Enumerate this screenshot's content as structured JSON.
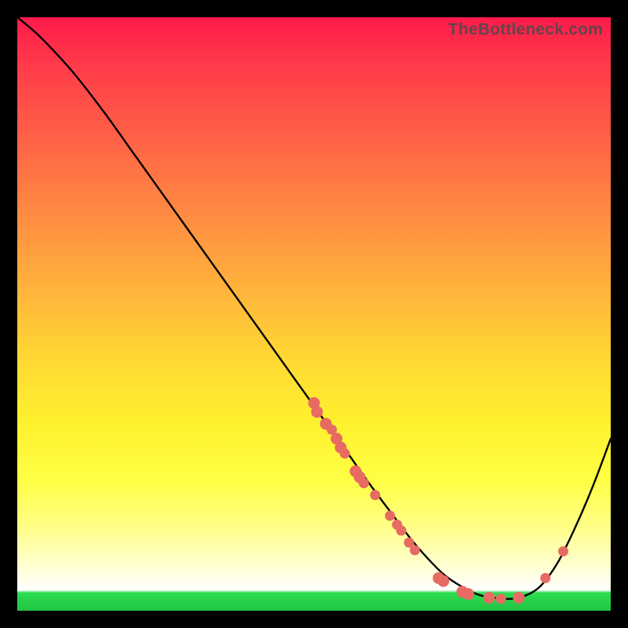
{
  "watermark": "TheBottleneck.com",
  "colors": {
    "dot": "#e86b63",
    "curve": "#000000",
    "frame_bg_top": "#ff1a4a",
    "frame_bg_bottom": "#22c545",
    "page_bg": "#000000"
  },
  "chart_data": {
    "type": "line",
    "title": "",
    "xlabel": "",
    "ylabel": "",
    "xlim": [
      0,
      100
    ],
    "ylim": [
      0,
      100
    ],
    "grid": false,
    "legend": false,
    "series": [
      {
        "name": "bottleneck-curve",
        "x": [
          0,
          3,
          6,
          10,
          15,
          20,
          25,
          30,
          35,
          40,
          45,
          50,
          55,
          60,
          63,
          66,
          69,
          72,
          75,
          78,
          81,
          83,
          85,
          88,
          91,
          94,
          97,
          100
        ],
        "y": [
          100,
          97.5,
          94.5,
          90,
          83.5,
          76.5,
          69.5,
          62.5,
          55.5,
          48.5,
          41.5,
          34.5,
          27.5,
          20.5,
          16.5,
          12.5,
          9,
          6,
          4,
          2.6,
          2.1,
          2.0,
          2.3,
          4,
          8,
          14,
          21,
          29
        ]
      }
    ],
    "points": [
      {
        "x": 50.0,
        "y": 35.0,
        "r": 7
      },
      {
        "x": 50.5,
        "y": 33.5,
        "r": 7
      },
      {
        "x": 52.0,
        "y": 31.5,
        "r": 7
      },
      {
        "x": 53.0,
        "y": 30.5,
        "r": 6
      },
      {
        "x": 53.8,
        "y": 29.0,
        "r": 7
      },
      {
        "x": 54.5,
        "y": 27.5,
        "r": 7
      },
      {
        "x": 55.2,
        "y": 26.5,
        "r": 6
      },
      {
        "x": 57.0,
        "y": 23.5,
        "r": 7
      },
      {
        "x": 57.7,
        "y": 22.5,
        "r": 7
      },
      {
        "x": 58.4,
        "y": 21.5,
        "r": 6
      },
      {
        "x": 60.3,
        "y": 19.5,
        "r": 6
      },
      {
        "x": 62.8,
        "y": 16.0,
        "r": 6
      },
      {
        "x": 64.0,
        "y": 14.5,
        "r": 6
      },
      {
        "x": 64.7,
        "y": 13.5,
        "r": 6
      },
      {
        "x": 66.0,
        "y": 11.5,
        "r": 6
      },
      {
        "x": 67.0,
        "y": 10.2,
        "r": 6
      },
      {
        "x": 71.0,
        "y": 5.5,
        "r": 7
      },
      {
        "x": 71.8,
        "y": 5.0,
        "r": 7
      },
      {
        "x": 75.0,
        "y": 3.2,
        "r": 7
      },
      {
        "x": 76.0,
        "y": 2.8,
        "r": 7
      },
      {
        "x": 79.5,
        "y": 2.2,
        "r": 7
      },
      {
        "x": 81.5,
        "y": 2.0,
        "r": 6
      },
      {
        "x": 84.5,
        "y": 2.2,
        "r": 7
      },
      {
        "x": 89.0,
        "y": 5.5,
        "r": 6
      },
      {
        "x": 92.0,
        "y": 10.0,
        "r": 6
      }
    ]
  }
}
